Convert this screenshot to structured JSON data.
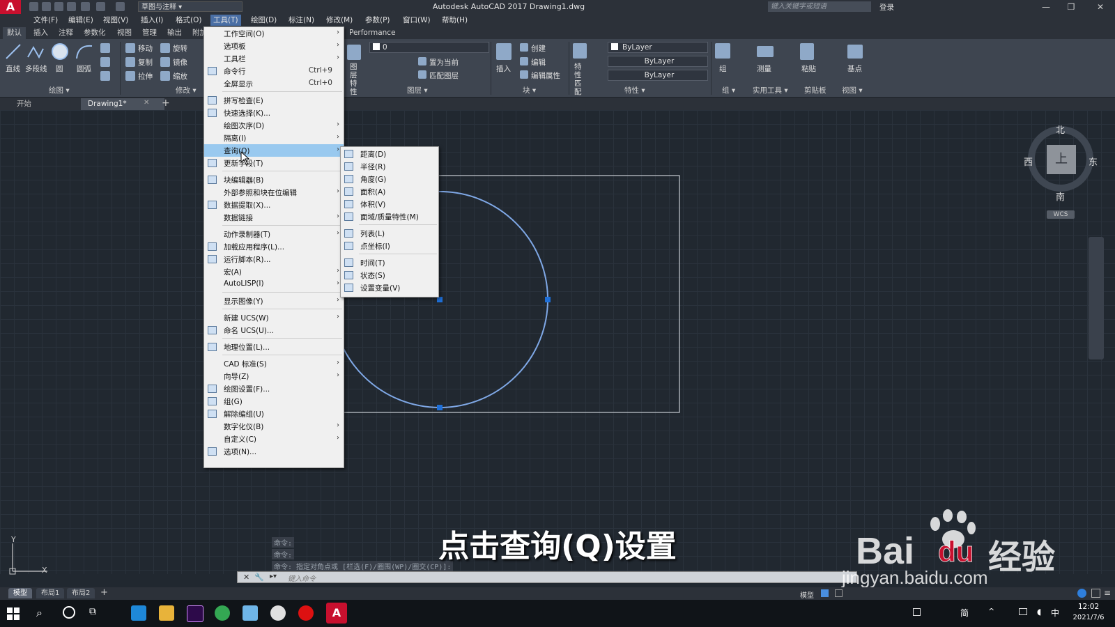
{
  "window": {
    "app_title": "Autodesk AutoCAD 2017    Drawing1.dwg",
    "workspace": "草图与注释",
    "search_placeholder": "键入关键字或短语",
    "login": "登录"
  },
  "menubar": [
    "文件(F)",
    "编辑(E)",
    "视图(V)",
    "插入(I)",
    "格式(O)",
    "工具(T)",
    "绘图(D)",
    "标注(N)",
    "修改(M)",
    "参数(P)",
    "窗口(W)",
    "帮助(H)"
  ],
  "ribbon_tabs": [
    "默认",
    "插入",
    "注释",
    "参数化",
    "视图",
    "管理",
    "输出",
    "附加",
    "Performance"
  ],
  "ribbon": {
    "draw_tools": [
      "直线",
      "多段线",
      "圆",
      "圆弧"
    ],
    "modify_tools": [
      "移动",
      "旋转",
      "复制",
      "镜像",
      "拉伸",
      "缩放"
    ],
    "layer_tools": [
      "置为当前",
      "匹配图层"
    ],
    "layer_value": "0",
    "layer_prop_label": "图层\n特性",
    "insert_label": "插入",
    "block_tools": [
      "创建",
      "编辑",
      "编辑属性"
    ],
    "match_label": "特性\n匹配",
    "props": [
      "ByLayer",
      "ByLayer",
      "ByLayer"
    ],
    "group_label": "组",
    "measure_label": "测量",
    "paste_label": "粘贴",
    "base_label": "基点",
    "panels": [
      "绘图",
      "修改",
      "图层",
      "块",
      "特性",
      "组",
      "实用工具",
      "剪贴板",
      "视图"
    ]
  },
  "doc_tabs": [
    "开始",
    "Drawing1*"
  ],
  "tools_menu": [
    {
      "label": "工作空间(O)",
      "sub": true
    },
    {
      "label": "选项板",
      "sub": true
    },
    {
      "label": "工具栏",
      "sub": true
    },
    {
      "label": "命令行",
      "shortcut": "Ctrl+9",
      "icon": "command-line-icon"
    },
    {
      "label": "全屏显示",
      "shortcut": "Ctrl+0"
    },
    {
      "sep": true
    },
    {
      "label": "拼写检查(E)",
      "icon": "spellcheck-icon"
    },
    {
      "label": "快速选择(K)...",
      "icon": "quick-select-icon"
    },
    {
      "label": "绘图次序(D)",
      "sub": true
    },
    {
      "label": "隔离(I)",
      "sub": true
    },
    {
      "label": "查询(Q)",
      "sub": true,
      "highlight": true
    },
    {
      "label": "更新字段(T)",
      "icon": "update-field-icon"
    },
    {
      "sep": true
    },
    {
      "label": "块编辑器(B)",
      "icon": "block-editor-icon"
    },
    {
      "label": "外部参照和块在位编辑",
      "sub": true
    },
    {
      "label": "数据提取(X)...",
      "icon": "data-extract-icon"
    },
    {
      "label": "数据链接",
      "sub": true
    },
    {
      "sep": true
    },
    {
      "label": "动作录制器(T)",
      "sub": true
    },
    {
      "label": "加载应用程序(L)...",
      "icon": "load-app-icon"
    },
    {
      "label": "运行脚本(R)...",
      "icon": "script-icon"
    },
    {
      "label": "宏(A)",
      "sub": true
    },
    {
      "label": "AutoLISP(I)",
      "sub": true
    },
    {
      "sep": true
    },
    {
      "label": "显示图像(Y)",
      "sub": true
    },
    {
      "sep": true
    },
    {
      "label": "新建 UCS(W)",
      "sub": true
    },
    {
      "label": "命名 UCS(U)...",
      "icon": "named-ucs-icon"
    },
    {
      "sep": true
    },
    {
      "label": "地理位置(L)...",
      "icon": "globe-icon"
    },
    {
      "sep": true
    },
    {
      "label": "CAD 标准(S)",
      "sub": true
    },
    {
      "label": "向导(Z)",
      "sub": true
    },
    {
      "label": "绘图设置(F)...",
      "icon": "drafting-settings-icon"
    },
    {
      "label": "组(G)",
      "icon": "group-icon"
    },
    {
      "label": "解除编组(U)",
      "icon": "ungroup-icon"
    },
    {
      "label": "数字化仪(B)",
      "sub": true
    },
    {
      "label": "自定义(C)",
      "sub": true
    },
    {
      "label": "选项(N)...",
      "icon": "options-check-icon"
    }
  ],
  "inquiry_menu": [
    {
      "label": "距离(D)",
      "icon": "distance-icon"
    },
    {
      "label": "半径(R)",
      "icon": "radius-icon"
    },
    {
      "label": "角度(G)",
      "icon": "angle-icon"
    },
    {
      "label": "面积(A)",
      "icon": "area-icon"
    },
    {
      "label": "体积(V)",
      "icon": "volume-icon"
    },
    {
      "label": "面域/质量特性(M)",
      "icon": "mass-properties-icon"
    },
    {
      "sep": true
    },
    {
      "label": "列表(L)",
      "icon": "list-icon"
    },
    {
      "label": "点坐标(I)",
      "icon": "point-coord-icon"
    },
    {
      "sep": true
    },
    {
      "label": "时间(T)",
      "icon": "clock-icon"
    },
    {
      "label": "状态(S)",
      "icon": "status-icon"
    },
    {
      "label": "设置变量(V)",
      "icon": "gear-icon"
    }
  ],
  "viewcube": {
    "north": "北",
    "south": "南",
    "east": "东",
    "west": "西",
    "face": "上",
    "wcs": "WCS"
  },
  "command": {
    "history": [
      "命令:",
      "命令:",
      "命令: 指定对角点或 [栏选(F)/圈围(WP)/圈交(CP)]:"
    ],
    "placeholder": "键入命令"
  },
  "layout_tabs": [
    "模型",
    "布局1",
    "布局2"
  ],
  "status_model": "模型",
  "subtitle": "点击查询(Q)设置",
  "watermark": {
    "brand": "Bai",
    "brand_mid": "du",
    "brand_cn": "经验",
    "url": "jingyan.baidu.com"
  },
  "clock": {
    "time": "12:02",
    "date": "2021/7/6"
  },
  "tray": {
    "ime": "简",
    "lang": "中"
  },
  "axis": {
    "y": "Y",
    "x": "X"
  },
  "colors": {
    "accent": "#4a6fa5",
    "menu_hl": "#99c9ef",
    "circle": "#6d9fe8",
    "grip": "#1e6fd8"
  }
}
